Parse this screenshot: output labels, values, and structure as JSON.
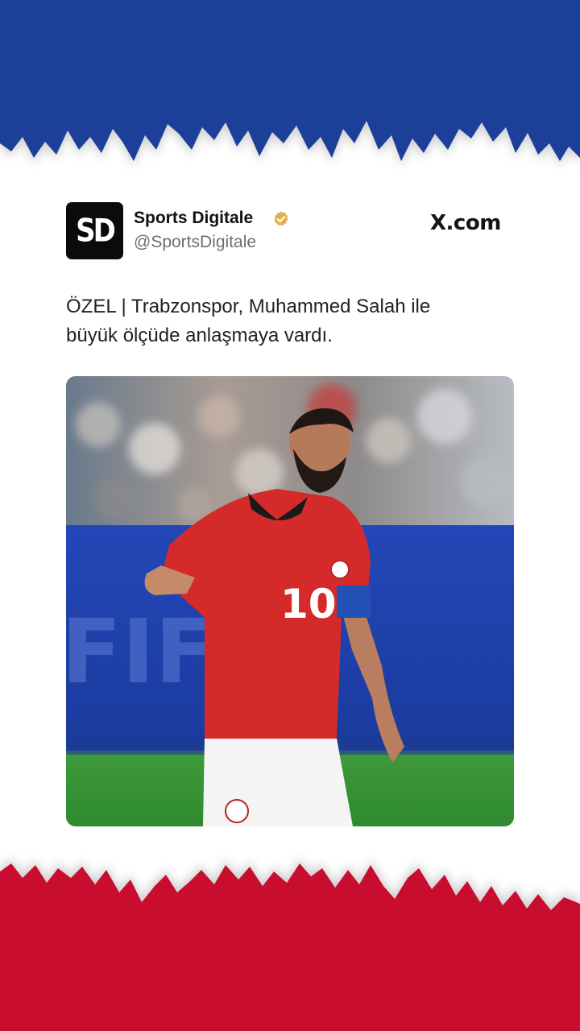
{
  "post": {
    "account_name": "Sports Digitale",
    "account_handle": "@SportsDigitale",
    "avatar_text": "SD",
    "platform_label": "X.com",
    "text_line1": "ÖZEL | Trabzonspor, Muhammed Salah ile",
    "text_line2": "büyük ölçüde anlaşmaya vardı.",
    "photo_jersey_number": "10"
  },
  "icons": {
    "verified": "verified-badge-icon",
    "platform": "x-logo-icon"
  },
  "colors": {
    "top_band": "#1e3f9a",
    "bottom_band": "#c8102e",
    "verified": "#e0b34a",
    "jersey": "#d42a2a"
  }
}
